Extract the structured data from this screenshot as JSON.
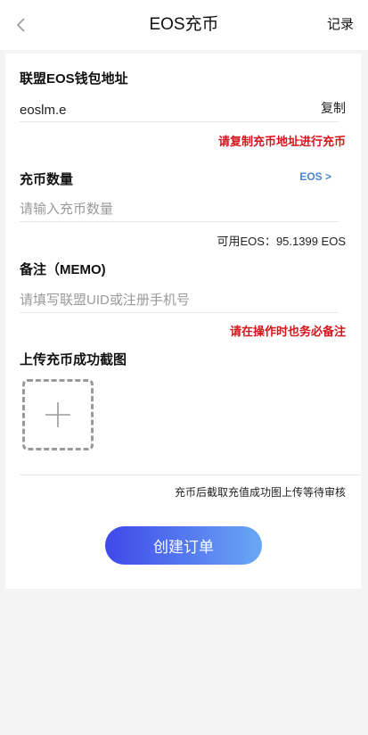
{
  "header": {
    "title": "EOS充币",
    "records_label": "记录"
  },
  "wallet": {
    "label": "联盟EOS钱包地址",
    "address": "eoslm.e",
    "copy_label": "复制",
    "copy_hint": "请复制充币地址进行充币"
  },
  "amount": {
    "label": "充币数量",
    "currency_selector": "EOS >",
    "placeholder": "请输入充币数量",
    "available": "可用EOS：95.1399 EOS"
  },
  "memo": {
    "label": "备注（MEMO)",
    "placeholder": "请填写联盟UID或注册手机号",
    "hint": "请在操作时也务必备注"
  },
  "upload": {
    "label": "上传充币成功截图",
    "icon": "plus-icon",
    "note": "充币后截取充值成功图上传等待审核"
  },
  "submit_label": "创建订单",
  "colors": {
    "accent_blue": "#4a86d4",
    "warning_red": "#d6141b",
    "button_gradient_start": "#3f48ea",
    "button_gradient_end": "#6aa8f4"
  }
}
